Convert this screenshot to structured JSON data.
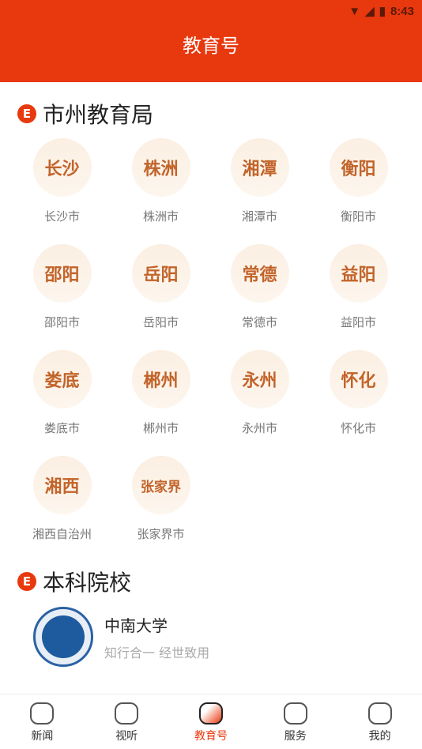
{
  "status": {
    "time": "8:43"
  },
  "header": {
    "title": "教育号"
  },
  "section1": {
    "title": "市州教育局",
    "badge": "E",
    "items": [
      {
        "short": "长沙",
        "label": "长沙市"
      },
      {
        "short": "株洲",
        "label": "株洲市"
      },
      {
        "short": "湘潭",
        "label": "湘潭市"
      },
      {
        "short": "衡阳",
        "label": "衡阳市"
      },
      {
        "short": "邵阳",
        "label": "邵阳市"
      },
      {
        "short": "岳阳",
        "label": "岳阳市"
      },
      {
        "short": "常德",
        "label": "常德市"
      },
      {
        "short": "益阳",
        "label": "益阳市"
      },
      {
        "short": "娄底",
        "label": "娄底市"
      },
      {
        "short": "郴州",
        "label": "郴州市"
      },
      {
        "short": "永州",
        "label": "永州市"
      },
      {
        "short": "怀化",
        "label": "怀化市"
      },
      {
        "short": "湘西",
        "label": "湘西自治州"
      },
      {
        "short": "张家界",
        "label": "张家界市"
      }
    ]
  },
  "section2": {
    "title": "本科院校",
    "badge": "E",
    "items": [
      {
        "name": "中南大学",
        "motto": "知行合一 经世致用"
      }
    ]
  },
  "nav": [
    {
      "label": "新闻"
    },
    {
      "label": "视听"
    },
    {
      "label": "教育号",
      "active": true
    },
    {
      "label": "服务"
    },
    {
      "label": "我的"
    }
  ]
}
